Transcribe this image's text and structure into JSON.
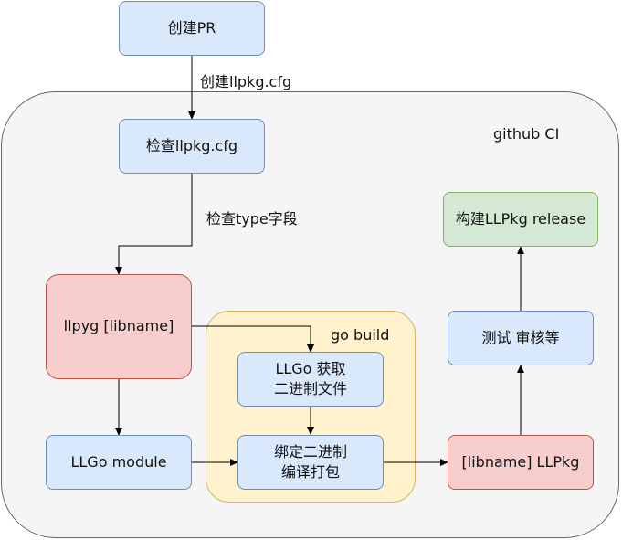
{
  "diagram": {
    "nodes": {
      "create_pr": "创建PR",
      "check_cfg": "检查llpkg.cfg",
      "llpyg": "llpyg [libname]",
      "llgo_module": "LLGo module",
      "llgo_fetch": "LLGo 获取\n二进制文件",
      "bind": "绑定二进制\n编译打包",
      "llpkg": "[libname] LLPkg",
      "test": "测试 审核等",
      "release": "构建LLPkg release"
    },
    "edge_labels": {
      "create_cfg": "创建llpkg.cfg",
      "check_type": "检查type字段"
    },
    "groups": {
      "github_ci": "github CI",
      "go_build": "go build"
    }
  }
}
